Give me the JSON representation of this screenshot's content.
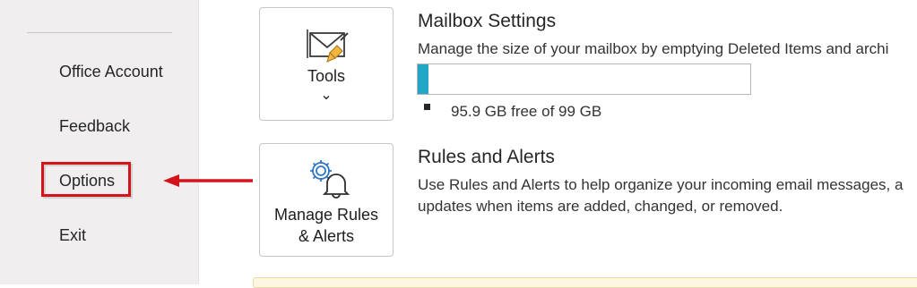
{
  "sidebar": {
    "items": [
      {
        "label": "Office Account"
      },
      {
        "label": "Feedback"
      },
      {
        "label": "Options",
        "highlighted": true
      },
      {
        "label": "Exit"
      }
    ]
  },
  "mailbox_settings": {
    "tool_button": {
      "label": "Tools",
      "icon": "mail-broom-icon",
      "chevron": "⌄"
    },
    "title": "Mailbox Settings",
    "description": "Manage the size of your mailbox by emptying Deleted Items and archi",
    "usage_fraction": 0.031,
    "quota_text": "95.9 GB free of 99 GB",
    "bar_color": "#23a7c7"
  },
  "rules_alerts": {
    "button": {
      "line1": "Manage Rules",
      "line2": "& Alerts",
      "icon": "gear-bell-icon"
    },
    "title": "Rules and Alerts",
    "description_line1": "Use Rules and Alerts to help organize your incoming email messages, a",
    "description_line2": "updates when items are added, changed, or removed."
  },
  "annotation": {
    "color": "#d4141b"
  }
}
